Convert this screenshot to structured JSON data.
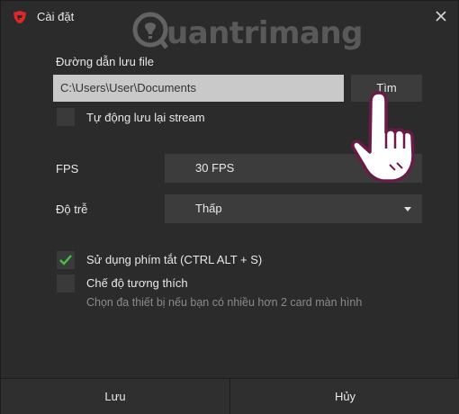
{
  "window": {
    "title": "Cài đặt"
  },
  "watermark": {
    "text": "uantrimang"
  },
  "path": {
    "label": "Đường dẫn lưu file",
    "value": "C:\\Users\\User\\Documents",
    "browse_label": "Tìm"
  },
  "auto_save": {
    "label": "Tự động lưu lại stream",
    "checked": false
  },
  "fps": {
    "label": "FPS",
    "value": "30 FPS"
  },
  "latency": {
    "label": "Độ trễ",
    "value": "Thấp"
  },
  "shortcut": {
    "label": "Sử dụng phím tắt (CTRL ALT + S)",
    "checked": true
  },
  "compat": {
    "label": "Chế độ tương thích",
    "checked": false,
    "hint": "Chọn đa thiết bị nếu bạn có nhiều hơn 2 card màn hình"
  },
  "footer": {
    "save_label": "Lưu",
    "cancel_label": "Hủy"
  },
  "colors": {
    "accent_check": "#3fc33f",
    "logo_red": "#e0262a"
  },
  "icons": [
    "garena-logo-icon",
    "close-icon",
    "checkmark-icon",
    "chevron-down-icon",
    "pointing-hand-icon"
  ]
}
